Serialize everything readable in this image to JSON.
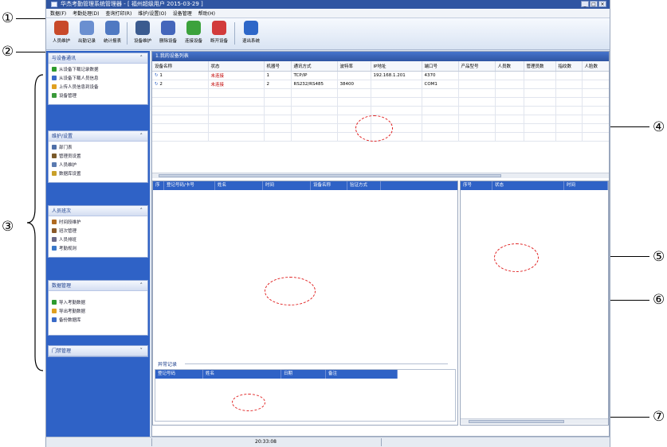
{
  "annotations": [
    "①",
    "②",
    "③",
    "④",
    "⑤",
    "⑥",
    "⑦"
  ],
  "window": {
    "title": "华杰考勤管理系统管理器 - [ 福州超级用户 2015-03-29 ]",
    "controls": [
      "_",
      "□",
      "×"
    ]
  },
  "menu": [
    "数据(F)",
    "考勤处理(D)",
    "查询打印(R)",
    "维护/设置(O)",
    "设备管理",
    "帮助(H)"
  ],
  "toolbar": {
    "buttons": [
      {
        "label": "人员维护",
        "icon": "people-icon",
        "color": "#c84a2a"
      },
      {
        "label": "出勤记录",
        "icon": "clock-icon",
        "color": "#6a8fd0"
      },
      {
        "label": "统计报表",
        "icon": "report-icon",
        "color": "#4f79c2"
      },
      {
        "label": "设备维护",
        "icon": "monitor-icon",
        "color": "#3b5b8f"
      },
      {
        "label": "删除设备",
        "icon": "delete-icon",
        "color": "#4466bb"
      },
      {
        "label": "连接设备",
        "icon": "connect-icon",
        "color": "#3ca23c"
      },
      {
        "label": "断开设备",
        "icon": "disconnect-icon",
        "color": "#d23b3b"
      },
      {
        "label": "退出系统",
        "icon": "power-icon",
        "color": "#2e67c8"
      }
    ]
  },
  "sidebar": {
    "panels": [
      {
        "title": "与设备通讯",
        "items": [
          {
            "label": "从设备下载记录数据",
            "icon": "download-icon",
            "color": "#2e9b2e"
          },
          {
            "label": "从设备下载人员信息",
            "icon": "download-user-icon",
            "color": "#3a6bc8"
          },
          {
            "label": "上传人员信息到设备",
            "icon": "upload-icon",
            "color": "#e0a020"
          },
          {
            "label": "设备管理",
            "icon": "device-icon",
            "color": "#3a9a3a"
          }
        ]
      },
      {
        "title": "维护/设置",
        "items": [
          {
            "label": "部门表",
            "icon": "department-icon",
            "color": "#4f6fa8"
          },
          {
            "label": "管理员设置",
            "icon": "admin-icon",
            "color": "#7a5a2a"
          },
          {
            "label": "人员维护",
            "icon": "person-icon",
            "color": "#5a7ab0"
          },
          {
            "label": "数据库设置",
            "icon": "database-icon",
            "color": "#c9a02a"
          }
        ]
      },
      {
        "title": "人员班次",
        "items": [
          {
            "label": "时间段维护",
            "icon": "timeslot-icon",
            "color": "#b06a20"
          },
          {
            "label": "班次管理",
            "icon": "shift-icon",
            "color": "#8a5a2a"
          },
          {
            "label": "人员排班",
            "icon": "schedule-icon",
            "color": "#6a6a8a"
          },
          {
            "label": "考勤规则",
            "icon": "rule-icon",
            "color": "#3a78c8"
          }
        ]
      },
      {
        "title": "数据管理",
        "items": [
          {
            "label": "导入考勤数据",
            "icon": "import-icon",
            "color": "#2e9b2e"
          },
          {
            "label": "导出考勤数据",
            "icon": "export-icon",
            "color": "#e0a020"
          },
          {
            "label": "备份数据库",
            "icon": "backup-icon",
            "color": "#3a6bc8"
          }
        ]
      },
      {
        "title": "门禁管理",
        "items": []
      }
    ]
  },
  "devices": {
    "tab": "1.我的设备列表",
    "columns": [
      "设备名称",
      "状态",
      "机器号",
      "通讯方式",
      "波特率",
      "IP地址",
      "端口号",
      "产品型号",
      "人员数",
      "管理员数",
      "指纹数",
      "人脸数"
    ],
    "rows": [
      [
        "1",
        "未连接",
        "1",
        "TCP/IP",
        "",
        "192.168.1.201",
        "4370",
        "",
        "",
        "",
        "",
        ""
      ],
      [
        "2",
        "未连接",
        "2",
        "RS232/RS485",
        "38400",
        "",
        "COM1",
        "",
        "",
        "",
        "",
        ""
      ]
    ],
    "empty_rows": 6
  },
  "records": {
    "columns": [
      "序",
      "登记号码/卡号",
      "姓名",
      "时间",
      "设备名称",
      "验证方式"
    ]
  },
  "device_log": {
    "columns": [
      "序号",
      "状态",
      "时间"
    ]
  },
  "exceptions": {
    "label": "异常记录",
    "columns": [
      "登记号码",
      "姓名",
      "日期",
      "备注"
    ]
  },
  "statusbar": {
    "clock": "20:33:08"
  }
}
